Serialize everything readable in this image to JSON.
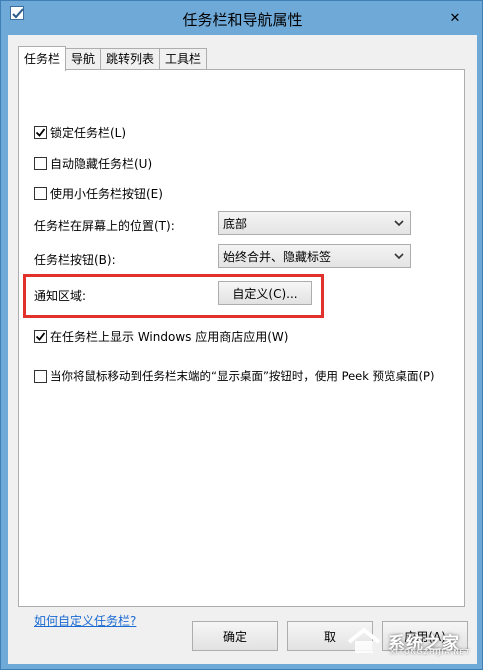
{
  "window": {
    "title": "任务栏和导航属性",
    "close_glyph": "✕"
  },
  "tabs": [
    {
      "label": "任务栏",
      "active": true
    },
    {
      "label": "导航",
      "active": false
    },
    {
      "label": "跳转列表",
      "active": false
    },
    {
      "label": "工具栏",
      "active": false
    }
  ],
  "settings": {
    "lock_taskbar": {
      "label": "锁定任务栏(L)",
      "checked": true
    },
    "auto_hide": {
      "label": "自动隐藏任务栏(U)",
      "checked": false
    },
    "small_buttons": {
      "label": "使用小任务栏按钮(E)",
      "checked": false
    },
    "position": {
      "label": "任务栏在屏幕上的位置(T):",
      "value": "底部"
    },
    "buttons": {
      "label": "任务栏按钮(B):",
      "value": "始终合并、隐藏标签"
    },
    "notification": {
      "label": "通知区域:",
      "button_label": "自定义(C)..."
    },
    "show_store_apps": {
      "label": "在任务栏上显示 Windows 应用商店应用(W)",
      "checked": true
    },
    "peek": {
      "label": "当你将鼠标移动到任务栏末端的“显示桌面”按钮时，使用 Peek 预览桌面(P)",
      "checked": false
    },
    "help_link": "如何自定义任务栏?"
  },
  "footer": {
    "ok_label": "确定",
    "cancel_label": "取",
    "apply_label": "应用(A)"
  },
  "watermark": {
    "text": "系统之家",
    "sub": "XITONGZHIJIA.NET"
  },
  "colors": {
    "titlebar": "#6fa9d7",
    "highlight_box": "#e0312b",
    "link": "#1a6ad3"
  }
}
